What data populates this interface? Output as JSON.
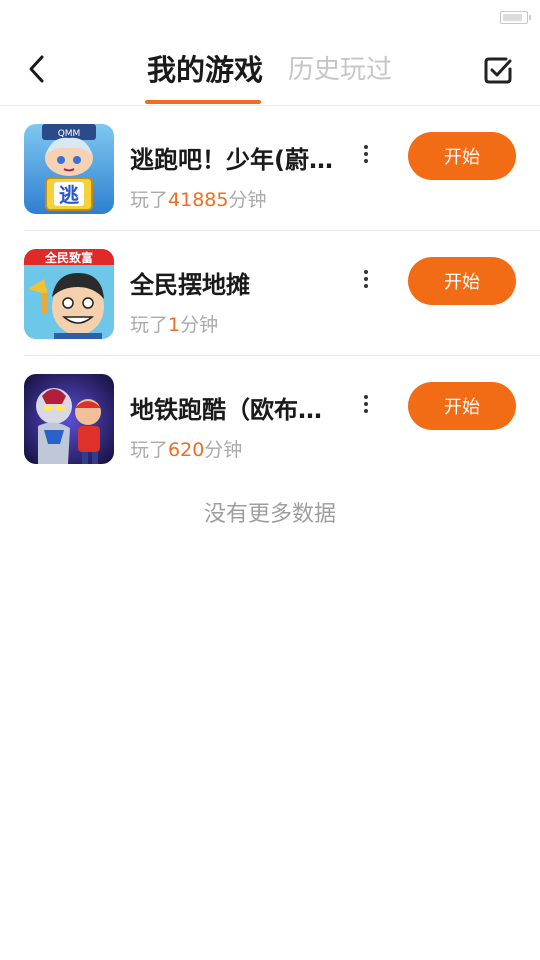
{
  "status_bar": {
    "battery_level": 0.9
  },
  "header": {
    "tabs": [
      {
        "label": "我的游戏",
        "active": true
      },
      {
        "label": "历史玩过",
        "active": false
      }
    ],
    "back_icon": "chevron-left-icon",
    "edit_icon": "checkbox-icon",
    "accent_color": "#ee6d1f"
  },
  "games": [
    {
      "title": "逃跑吧！少年(蔚来版)",
      "played_prefix": "玩了",
      "played_minutes": "41885",
      "played_suffix": "分钟",
      "start_label": "开始",
      "icon_text": "逃",
      "icon_badge": "QMM"
    },
    {
      "title": "全民摆地摊",
      "played_prefix": "玩了",
      "played_minutes": "1",
      "played_suffix": "分钟",
      "start_label": "开始",
      "icon_text": "全民致富"
    },
    {
      "title": "地铁跑酷（欧布版）",
      "played_prefix": "玩了",
      "played_minutes": "620",
      "played_suffix": "分钟",
      "start_label": "开始"
    }
  ],
  "footer": {
    "no_more_text": "没有更多数据"
  }
}
